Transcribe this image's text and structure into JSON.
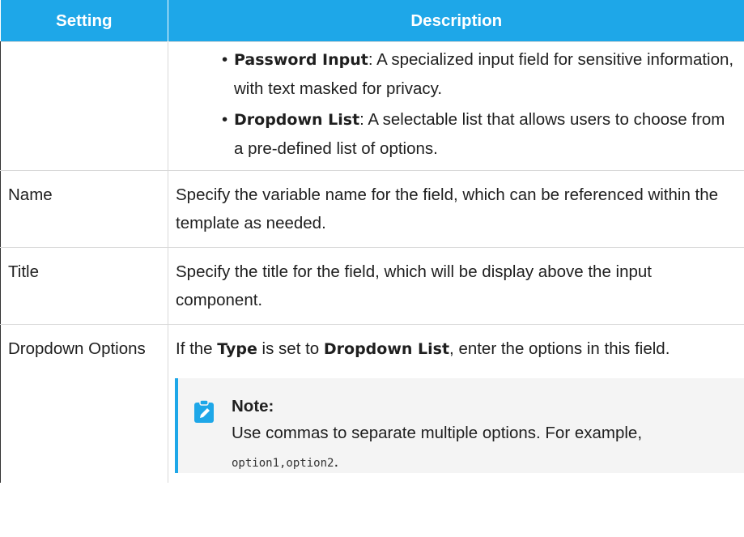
{
  "table": {
    "headers": {
      "setting": "Setting",
      "description": "Description"
    },
    "type_row": {
      "items": [
        {
          "term": "Password Input",
          "text": ": A specialized input field for sensitive information, with text masked for privacy."
        },
        {
          "term": "Dropdown List",
          "text": ": A selectable list that allows users to choose from a pre-defined list of options."
        }
      ]
    },
    "name_row": {
      "setting": "Name",
      "description": "Specify the variable name for the field, which can be referenced within the template as needed."
    },
    "title_row": {
      "setting": "Title",
      "description": "Specify the title for the field, which will be display above the input component."
    },
    "dropdown_row": {
      "setting": "Dropdown Options",
      "desc_prefix": "If the ",
      "kw_type": "Type",
      "desc_middle": " is set to ",
      "kw_dropdown": "Dropdown List",
      "desc_suffix": ", enter the options in this field.",
      "note": {
        "title": "Note:",
        "body_prefix": "Use commas to separate multiple options. For example, ",
        "code": "option1,option2",
        "body_suffix": "."
      }
    }
  },
  "colors": {
    "header_bg": "#1ea7e8",
    "note_bg": "#f4f4f4",
    "note_accent": "#1ea7e8"
  },
  "icons": {
    "note": "note-edit-icon"
  }
}
